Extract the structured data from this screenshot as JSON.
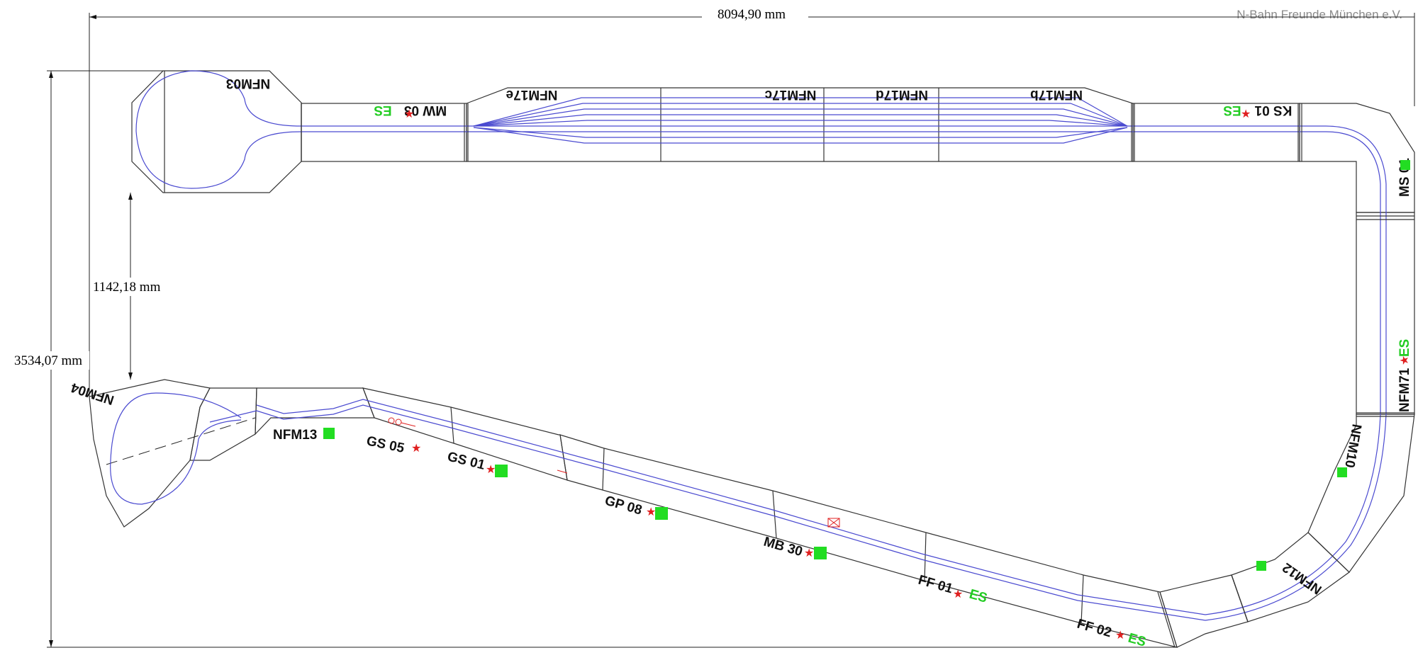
{
  "title_org": "N-Bahn Freunde München e.V.",
  "dimensions": {
    "width": "8094,90 mm",
    "height": "3534,07 mm",
    "gap": "1142,18 mm"
  },
  "modules": {
    "nfm03": "NFM03",
    "mw03": "MW 03",
    "nfm17e": "NFM17e",
    "nfm17c": "NFM17c",
    "nfm17d": "NFM17d",
    "nfm17b": "NFM17b",
    "ks01": "KS 01",
    "ms01": "MS 01",
    "nfm71": "NFM71",
    "nfm10": "NFM10",
    "nfm12": "NFM12",
    "ff02": "FF 02",
    "ff01": "FF 01",
    "mb30": "MB 30",
    "gp08": "GP 08",
    "gs01": "GS 01",
    "gs05": "GS 05",
    "nfm13": "NFM13",
    "nfm04": "NFM04"
  },
  "es_label": "ES",
  "colors": {
    "track": "#4a4ad0",
    "star": "#e02020",
    "marker": "#22dd22",
    "es_text": "#22cc22"
  },
  "symbols": {
    "star": "★",
    "marker_icon": "green-square-icon",
    "star_icon": "red-star-icon"
  }
}
